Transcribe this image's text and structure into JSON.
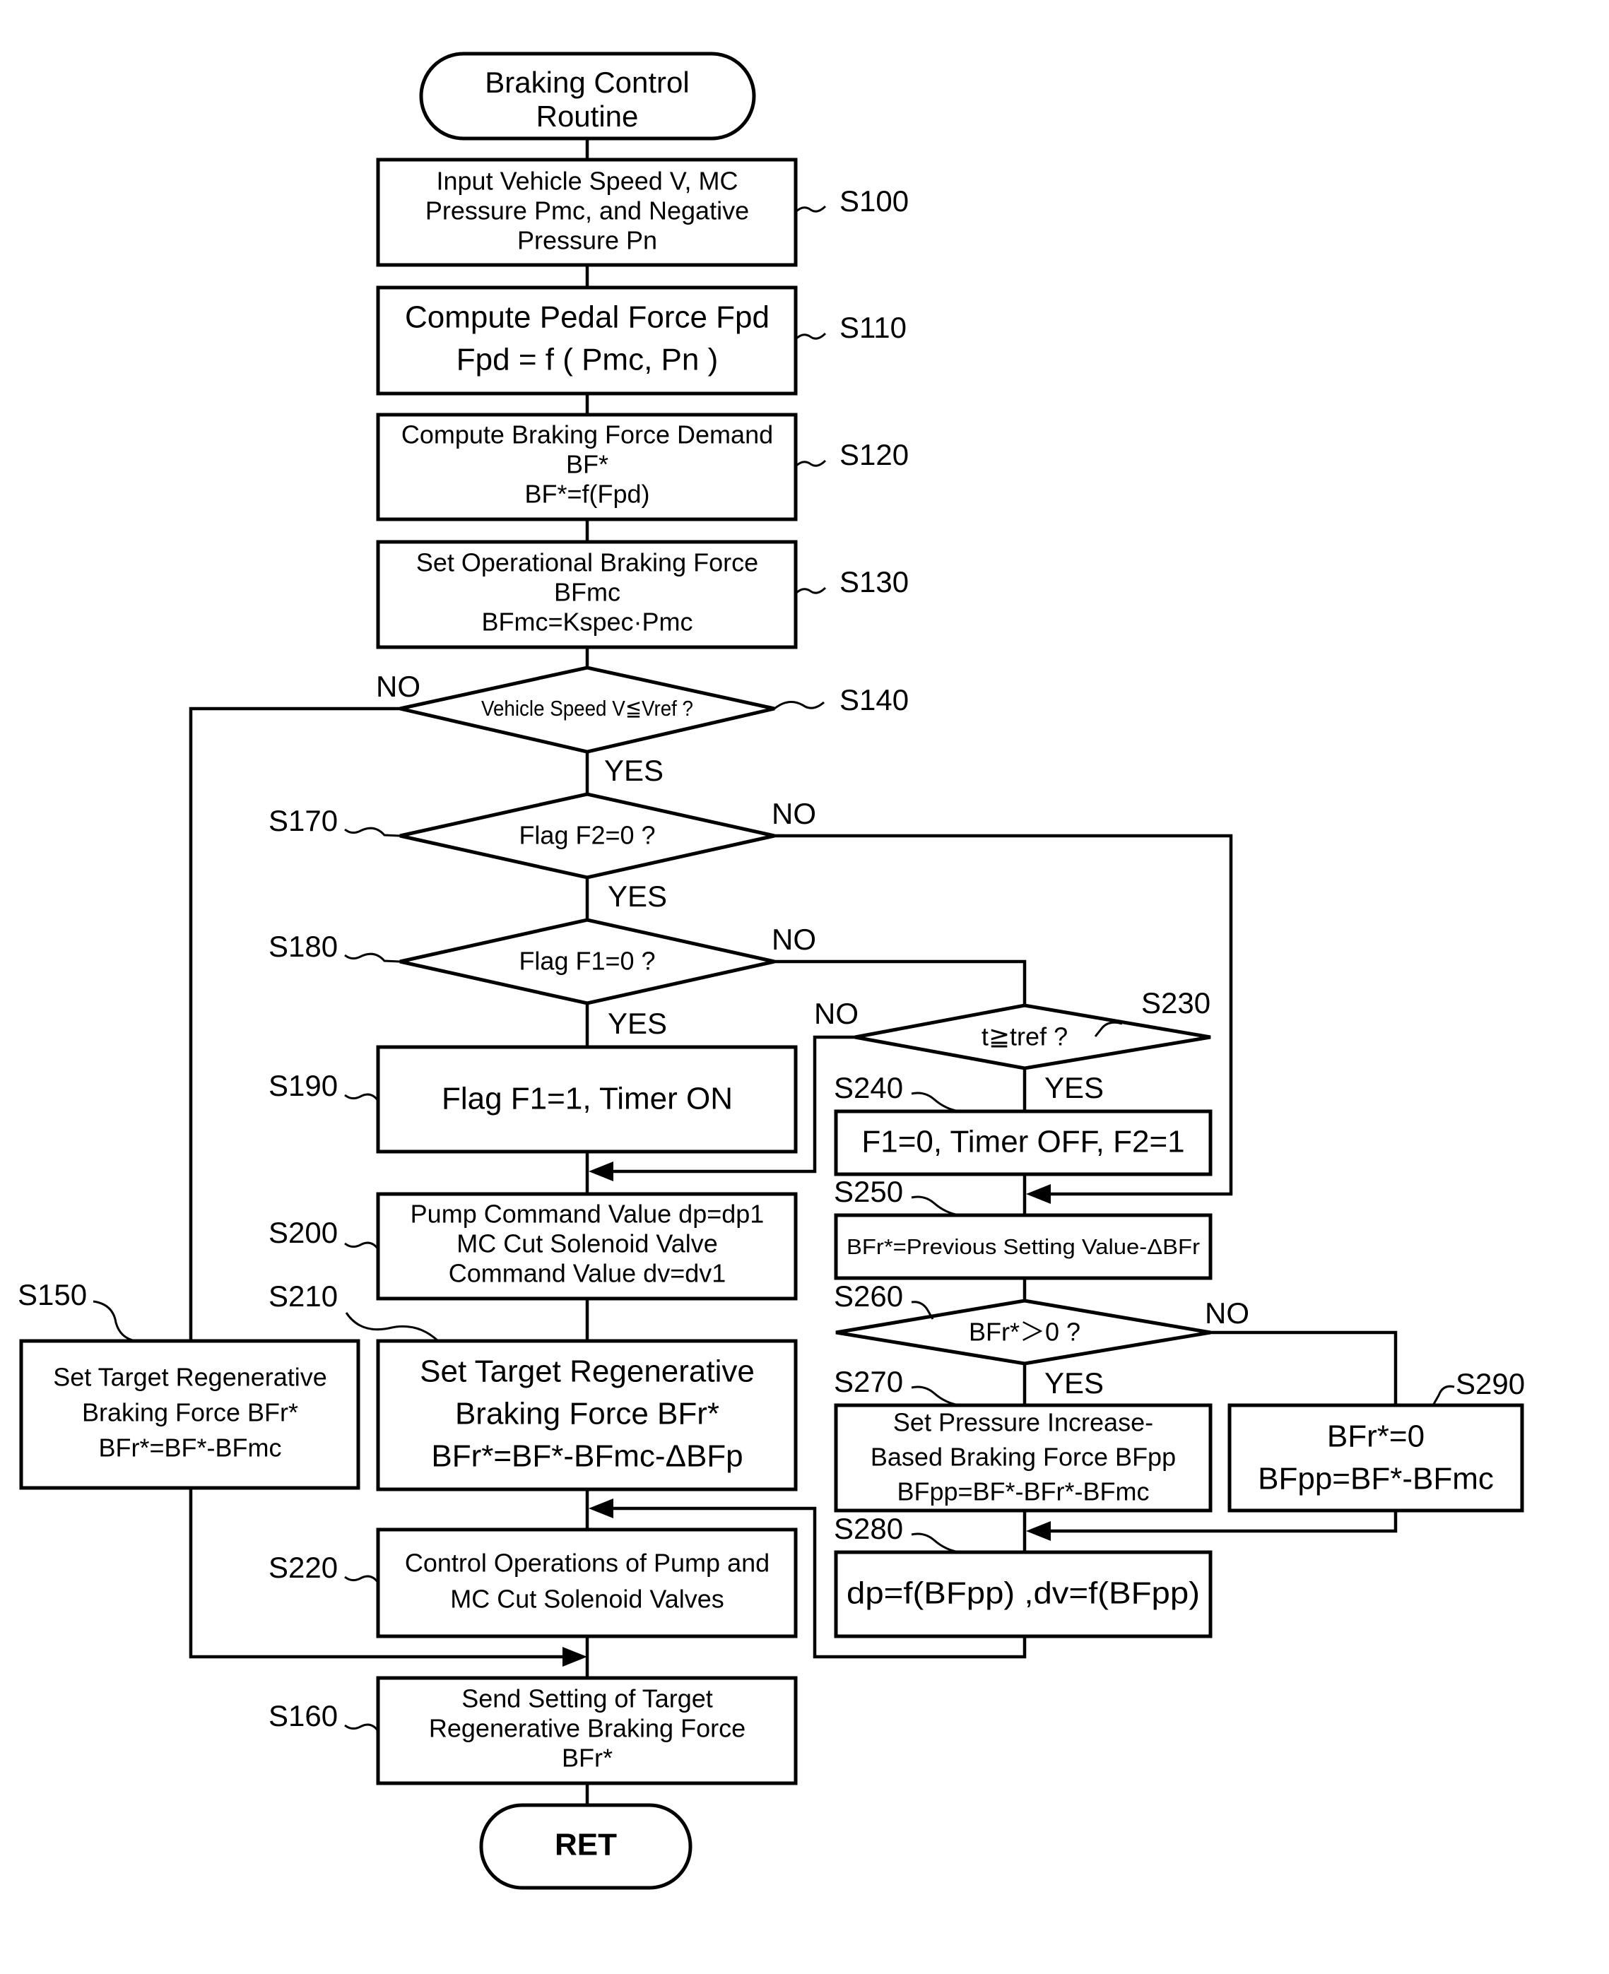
{
  "title": "Braking Control Routine",
  "start": {
    "lines": [
      "Braking Control",
      "Routine"
    ]
  },
  "end": {
    "label": "RET"
  },
  "steps": {
    "S100": {
      "id": "S100",
      "lines": [
        "Input Vehicle Speed V, MC",
        "Pressure Pmc, and Negative",
        "Pressure Pn"
      ]
    },
    "S110": {
      "id": "S110",
      "lines": [
        "Compute Pedal Force Fpd",
        "Fpd = f ( Pmc, Pn )"
      ]
    },
    "S120": {
      "id": "S120",
      "lines": [
        "Compute Braking Force Demand",
        "BF*",
        "BF*=f(Fpd)"
      ]
    },
    "S130": {
      "id": "S130",
      "lines": [
        "Set Operational Braking Force",
        "BFmc",
        "BFmc=Kspec·Pmc"
      ]
    },
    "S140": {
      "id": "S140",
      "question": "Vehicle Speed V≦Vref ?",
      "yes": "YES",
      "no": "NO"
    },
    "S150": {
      "id": "S150",
      "lines": [
        "Set Target Regenerative",
        "Braking Force BFr*",
        "BFr*=BF*-BFmc"
      ]
    },
    "S160": {
      "id": "S160",
      "lines": [
        "Send Setting of Target",
        "Regenerative Braking Force",
        "BFr*"
      ]
    },
    "S170": {
      "id": "S170",
      "question": "Flag F2=0 ?",
      "yes": "YES",
      "no": "NO"
    },
    "S180": {
      "id": "S180",
      "question": "Flag F1=0 ?",
      "yes": "YES",
      "no": "NO"
    },
    "S190": {
      "id": "S190",
      "lines": [
        "Flag F1=1, Timer ON"
      ]
    },
    "S200": {
      "id": "S200",
      "lines": [
        "Pump Command Value dp=dp1",
        "MC Cut Solenoid Valve",
        "Command Value dv=dv1"
      ]
    },
    "S210": {
      "id": "S210",
      "lines": [
        "Set Target Regenerative",
        "Braking Force BFr*",
        "BFr*=BF*-BFmc-ΔBFp"
      ]
    },
    "S220": {
      "id": "S220",
      "lines": [
        "Control Operations of Pump and",
        "MC Cut Solenoid Valves"
      ]
    },
    "S230": {
      "id": "S230",
      "question": "t≧tref ?",
      "yes": "YES",
      "no": "NO"
    },
    "S240": {
      "id": "S240",
      "lines": [
        "F1=0,  Timer OFF,  F2=1"
      ]
    },
    "S250": {
      "id": "S250",
      "lines": [
        "BFr*=Previous Setting Value-ΔBFr"
      ]
    },
    "S260": {
      "id": "S260",
      "question": "BFr*＞0 ?",
      "yes": "YES",
      "no": "NO"
    },
    "S270": {
      "id": "S270",
      "lines": [
        "Set Pressure Increase-",
        "Based Braking Force BFpp",
        "BFpp=BF*-BFr*-BFmc"
      ]
    },
    "S280": {
      "id": "S280",
      "lines": [
        "dp=f(BFpp) ,dv=f(BFpp)"
      ]
    },
    "S290": {
      "id": "S290",
      "lines": [
        "BFr*=0",
        "BFpp=BF*-BFmc"
      ]
    }
  }
}
